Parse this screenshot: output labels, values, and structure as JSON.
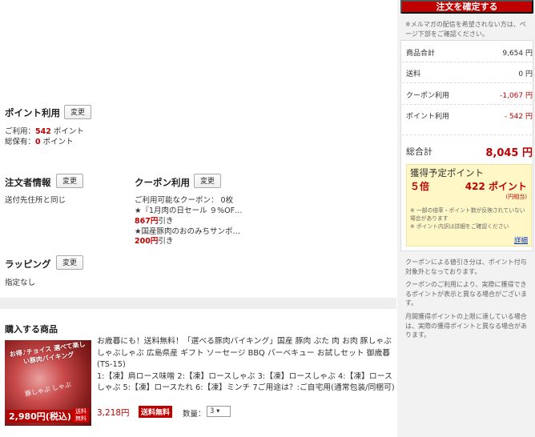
{
  "points": {
    "title": "ポイント利用",
    "change_label": "変更",
    "use_prefix": "ご利用：",
    "use_value": "542",
    "use_suffix": " ポイント",
    "own_prefix": "総保有：",
    "own_value": "0",
    "own_suffix": " ポイント"
  },
  "orderer": {
    "title": "注文者情報",
    "change_label": "変更",
    "value": "送付先住所と同じ"
  },
  "coupon": {
    "title": "クーポン利用",
    "change_label": "変更",
    "available": "ご利用可能なクーポン： 0枚",
    "items": [
      {
        "name": "★『1月肉の日セール ９%OF…",
        "discount": "867円",
        "suffix": "引き"
      },
      {
        "name": "★国産豚肉のおのみちサンポ…",
        "discount": "200円",
        "suffix": "引き"
      }
    ]
  },
  "wrapping": {
    "title": "ラッピング",
    "change_label": "変更",
    "value": "指定なし"
  },
  "product_section": {
    "title": "購入する商品",
    "image": {
      "tag1": "お得♪チョイス 選べて楽しい豚肉バイキング",
      "tag2": "豚しゃぶ しゃぶ",
      "price": "2,980円(税込)",
      "ship": "送料無料"
    },
    "description": "お歳暮にも！送料無料！「選べる豚肉バイキング」国産 豚肉 ぶた 肉 お肉 豚しゃぶ しゃぶしゃぶ 広島県産 ギフト ソーセージ BBQ バーベキュー お試しセット 御歳暮 (TS-15)",
    "options": "1:【凍】肩ロース味噌 2:【凍】ロースしゃぶ 3:【凍】ロースしゃぶ 4:【凍】ロースしゃぶ 5:【凍】ロースたれ 6:【凍】ミンチ 7ご用途は？:ご自宅用(通常包装/同梱可)",
    "price": "3,218円",
    "free_shipping": "送料無料",
    "qty_label": "数量：",
    "qty_value": "3 ▾"
  },
  "summary": {
    "confirm_label": "注文を確定する",
    "mailmag_note": "※メルマガの配信を希望されない方は、ページ下部をご確認ください。",
    "rows": [
      {
        "label": "商品合計",
        "value": "9,654 円"
      },
      {
        "label": "送料",
        "value": "0 円"
      },
      {
        "label": "クーポン利用",
        "value": "-1,067 円"
      },
      {
        "label": "ポイント利用",
        "value": "- 542 円"
      }
    ],
    "total_label": "総合計",
    "total_value": "8,045 円",
    "points_box": {
      "title": "獲得予定ポイント",
      "multiplier": "５倍",
      "value": "422 ポイント",
      "eq": "(円相当)",
      "note1": "※ 一部の倍率・ポイント数が反映されていない場合があります",
      "note2": "※ ポイント内訳は詳細をご確認ください",
      "more": "詳細"
    },
    "note_coupon": "クーポンによる値引き分は、ポイント付与対象外となっております。",
    "note_coupon2": "クーポンのご利用により、実際に獲得できるポイントが表示と異なる場合がございます。",
    "note_limit": "月間獲得ポイントの上限に達している場合は、実際の獲得ポイントと異なる場合があります。"
  },
  "colors": {
    "accent": "#bf0000",
    "panel_bg": "#f2f2f2",
    "points_bg": "#fff8c6",
    "link": "#0033cc"
  }
}
